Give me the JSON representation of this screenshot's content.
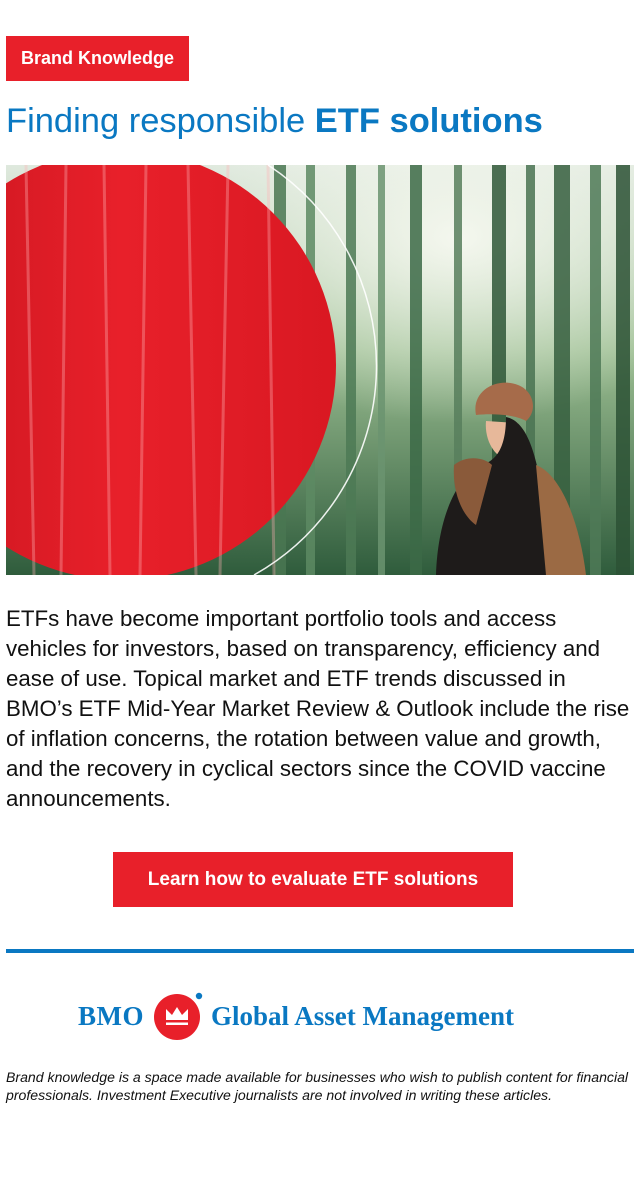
{
  "badge": {
    "label": "Brand Knowledge"
  },
  "headline": {
    "lead": "Finding responsible ",
    "emphasis": "ETF solutions"
  },
  "hero": {
    "description": "photo",
    "colors": {
      "red_disc": "#e8202a",
      "forest": "#3f7a52"
    }
  },
  "body": {
    "paragraph": "ETFs have become important portfolio tools and access vehicles for investors, based on transparency, efficiency and ease of use. Topical market and ETF trends discussed in BMO’s ETF Mid-Year Market Review & Outlook include the rise of inflation concerns, the rotation between value and growth, and the recovery in cyclical sectors since the COVID vaccine announcements."
  },
  "cta": {
    "label": "Learn how to evaluate ETF solutions"
  },
  "brand": {
    "prefix": "BMO",
    "name": "Global Asset Management",
    "logo_icon": "bmo-roundel-icon",
    "colors": {
      "brand_blue": "#0a78c2",
      "brand_red": "#e8202a"
    }
  },
  "disclaimer": {
    "text": "Brand knowledge is a space made available for businesses who wish to publish content for financial professionals. Investment Executive journalists are not involved in writing these articles."
  }
}
